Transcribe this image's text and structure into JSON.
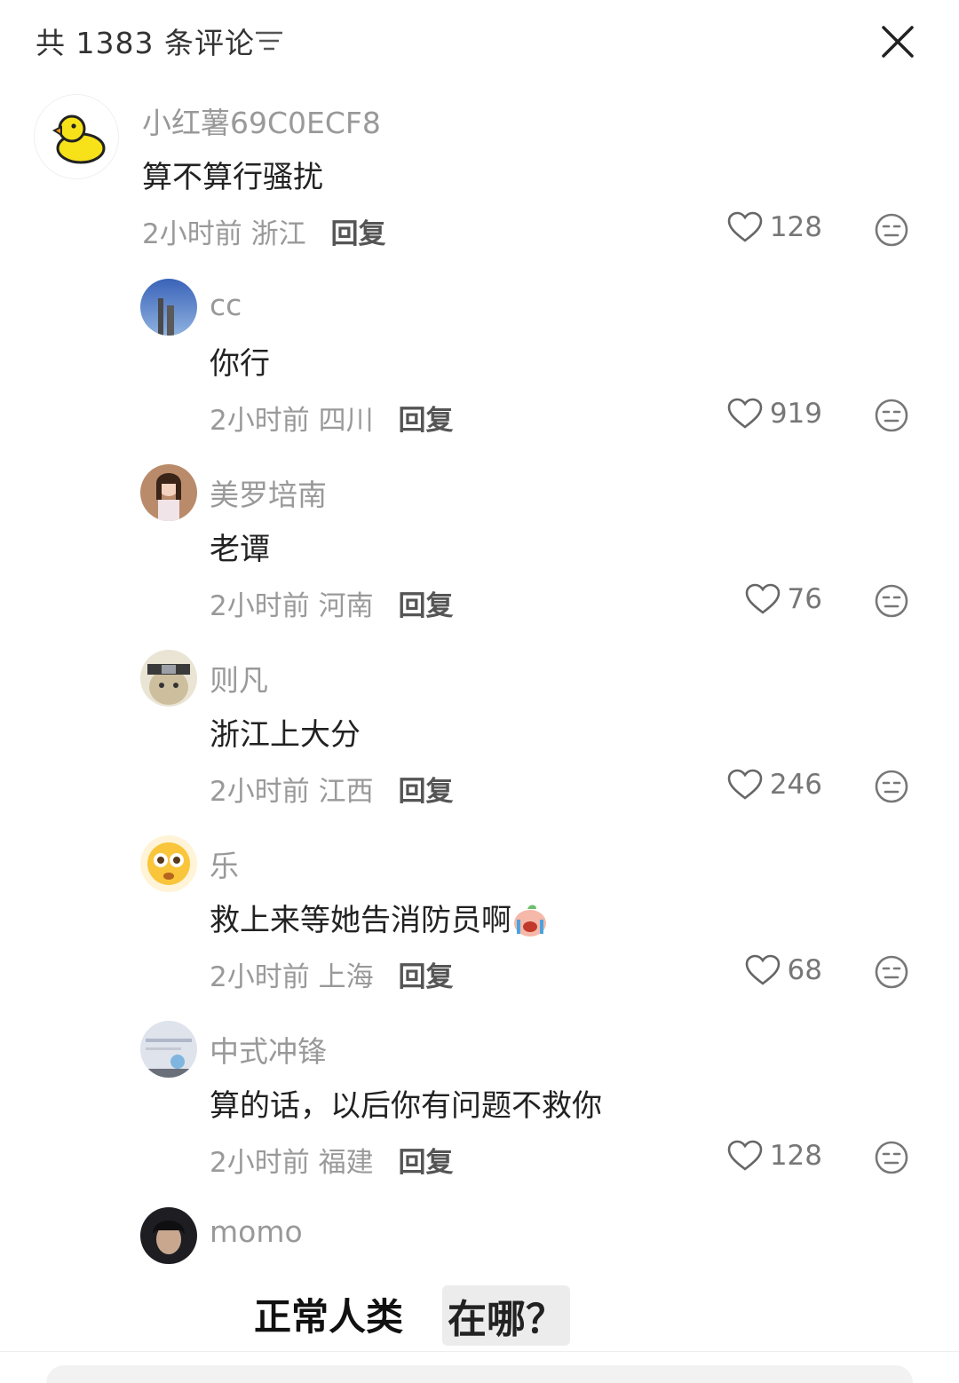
{
  "header": {
    "title": "共 1383 条评论"
  },
  "main_comment": {
    "username": "小红薯69C0ECF8",
    "text": "算不算行骚扰",
    "time": "2小时前",
    "location": "浙江",
    "reply_label": "回复",
    "likes": "128"
  },
  "replies": [
    {
      "username": "cc",
      "text": "你行",
      "time": "2小时前",
      "location": "四川",
      "reply_label": "回复",
      "likes": "919"
    },
    {
      "username": "美罗培南",
      "text": "老谭",
      "time": "2小时前",
      "location": "河南",
      "reply_label": "回复",
      "likes": "76"
    },
    {
      "username": "则凡",
      "text": "浙江上大分",
      "time": "2小时前",
      "location": "江西",
      "reply_label": "回复",
      "likes": "246"
    },
    {
      "username": "乐",
      "text": "救上来等她告消防员啊",
      "time": "2小时前",
      "location": "上海",
      "reply_label": "回复",
      "likes": "68"
    },
    {
      "username": "中式冲锋",
      "text": "算的话，以后你有问题不救你",
      "time": "2小时前",
      "location": "福建",
      "reply_label": "回复",
      "likes": "128"
    },
    {
      "username": "momo"
    }
  ],
  "sticker": {
    "text1": "正常人类",
    "text2": "在哪？"
  }
}
